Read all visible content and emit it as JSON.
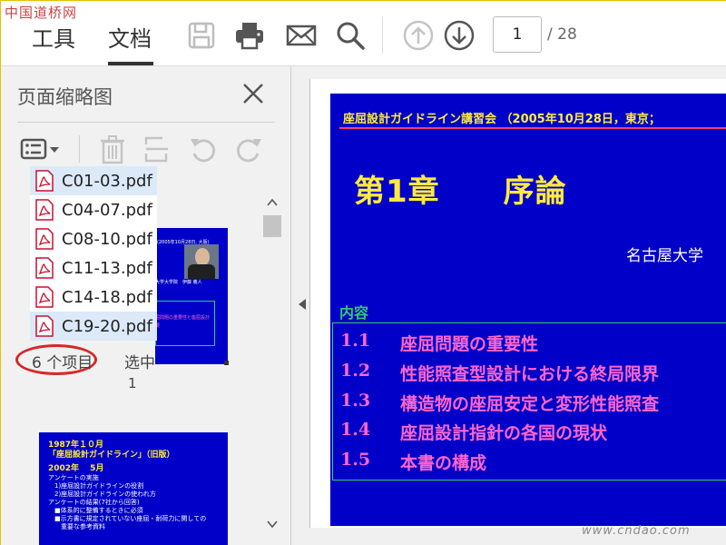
{
  "watermark": "中国道桥网",
  "tabs": {
    "tools": "工具",
    "document": "文档"
  },
  "toolbar": {
    "save_icon": "save-icon",
    "print_icon": "print-icon",
    "mail_icon": "mail-icon",
    "search_icon": "search-icon",
    "prev_icon": "arrow-up-circle-icon",
    "next_icon": "arrow-down-circle-icon",
    "page_current": "1",
    "page_total": "/ 28"
  },
  "sidebar": {
    "title": "页面缩略图",
    "items": [
      {
        "label": "C01-03.pdf",
        "selected": true
      },
      {
        "label": "C04-07.pdf",
        "selected": false
      },
      {
        "label": "C08-10.pdf",
        "selected": false
      },
      {
        "label": "C11-13.pdf",
        "selected": false
      },
      {
        "label": "C14-18.pdf",
        "selected": false
      },
      {
        "label": "C19-20.pdf",
        "selected": true
      }
    ],
    "count_text": "6 个项目",
    "selected_text": "选中",
    "selected_num": "1"
  },
  "thumb1": {
    "header": "(2005年10月28日, 大阪)",
    "name_line": "大学大学院　伊藤 義人",
    "pink_line1": "屈問題の重要性と座屈設計",
    "pink_line2": "要"
  },
  "thumb2": {
    "lines": [
      "1987年１０月",
      "「座屈設計ガイドライン」（旧版）",
      "2002年　 5月"
    ],
    "small": [
      "アンケートの実施",
      "　1)座屈設計ガイドラインの役割",
      "　2)座屈設計ガイドラインの使われ方",
      "",
      "アンケートの結果(7社から回答)",
      "　■体系的に整備するときに必須",
      "　■示方書に規定されていない座屈・耐荷力に関しての",
      "　　重要な参考資料"
    ]
  },
  "slide": {
    "header": "座屈設計ガイドライン講習会 （2005年10月28日，東京；",
    "chapter": "第1章　　序論",
    "author": "名古屋大学",
    "contents_label": "内容",
    "toc": [
      {
        "num": "1.1",
        "title": "座屈問題の重要性"
      },
      {
        "num": "1.2",
        "title": "性能照査型設計における終局限界"
      },
      {
        "num": "1.3",
        "title": "構造物の座屈安定と変形性能照査"
      },
      {
        "num": "1.4",
        "title": "座屈設計指針の各国の現状"
      },
      {
        "num": "1.5",
        "title": "本書の構成"
      }
    ]
  },
  "site_mark": "www.cndao.com",
  "colors": {
    "slide_bg": "#0000c8",
    "yellow": "#ffeb3b",
    "pink": "#ff66cc",
    "green": "#33cc66",
    "red_oval": "#d62828"
  }
}
